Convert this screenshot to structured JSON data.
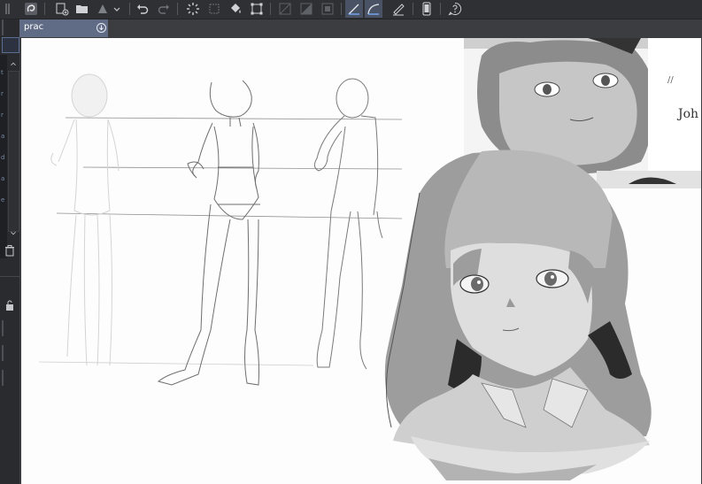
{
  "document": {
    "tab_name": "prac"
  },
  "toolbar": {
    "tools": [
      "app-logo",
      "new-canvas",
      "open-file",
      "save",
      "undo",
      "redo",
      "fill",
      "transform",
      "ruler",
      "snap",
      "help"
    ]
  },
  "reference_image": {
    "visible_text": "Joh"
  },
  "colors": {
    "toolbar_bg": "#2f3033",
    "tab_active": "#606c86",
    "canvas": "#fdfdfd",
    "panel_bg": "#2a2b2e",
    "tool_active": "#4a5366"
  }
}
